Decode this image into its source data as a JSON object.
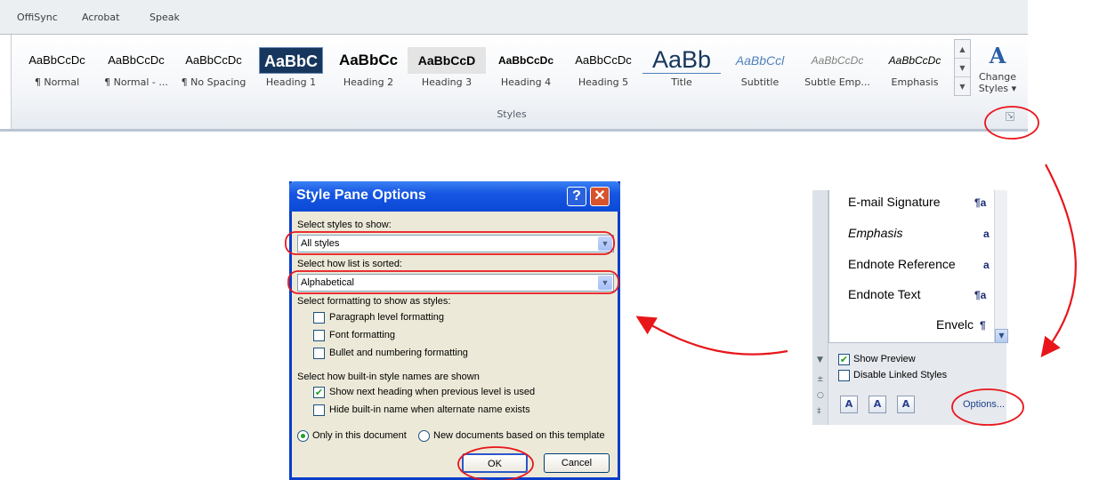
{
  "ribbon": {
    "tabs": [
      {
        "label": "OffiSync"
      },
      {
        "label": "Acrobat"
      },
      {
        "label": "Speak"
      }
    ],
    "gallery": [
      {
        "preview": "AaBbCcDc",
        "name": "¶ Normal"
      },
      {
        "preview": "AaBbCcDc",
        "name": "¶ Normal - ..."
      },
      {
        "preview": "AaBbCcDc",
        "name": "¶ No Spacing"
      },
      {
        "preview": "AaBbC",
        "name": "Heading 1"
      },
      {
        "preview": "AaBbCc",
        "name": "Heading 2"
      },
      {
        "preview": "AaBbCcD",
        "name": "Heading 3"
      },
      {
        "preview": "AaBbCcDc",
        "name": "Heading 4"
      },
      {
        "preview": "AaBbCcDc",
        "name": "Heading 5"
      },
      {
        "preview": "AaBb",
        "name": "Title"
      },
      {
        "preview": "AaBbCcl",
        "name": "Subtitle"
      },
      {
        "preview": "AaBbCcDc",
        "name": "Subtle Emp..."
      },
      {
        "preview": "AaBbCcDc",
        "name": "Emphasis"
      }
    ],
    "change_styles_label": "Change Styles ▾",
    "group_label": "Styles"
  },
  "dialog": {
    "title": "Style Pane Options",
    "help_glyph": "?",
    "close_glyph": "✕",
    "select_styles_label": "Select styles to show:",
    "select_styles_value": "All styles",
    "sort_label": "Select how list is sorted:",
    "sort_value": "Alphabetical",
    "formatting_label": "Select formatting to show as styles:",
    "formatting_options": [
      {
        "label": "Paragraph level formatting",
        "checked": false
      },
      {
        "label": "Font formatting",
        "checked": false
      },
      {
        "label": "Bullet and numbering formatting",
        "checked": false
      }
    ],
    "builtin_label": "Select how built-in style names are shown",
    "builtin_options": [
      {
        "label": "Show next heading when previous level is used",
        "checked": true
      },
      {
        "label": "Hide built-in name when alternate name exists",
        "checked": false
      }
    ],
    "scope_options": [
      {
        "label": "Only in this document",
        "selected": true
      },
      {
        "label": "New documents based on this template",
        "selected": false
      }
    ],
    "ok_label": "OK",
    "cancel_label": "Cancel"
  },
  "styles_pane": {
    "items": [
      {
        "name": "E-mail Signature",
        "mark": "¶a"
      },
      {
        "name": "Emphasis",
        "mark": "a"
      },
      {
        "name": "Endnote Reference",
        "mark": "a"
      },
      {
        "name": "Endnote Text",
        "mark": "¶a"
      },
      {
        "name": "Envelc",
        "mark": "¶"
      }
    ],
    "show_preview_label": "Show Preview",
    "show_preview_checked": true,
    "disable_linked_label": "Disable Linked Styles",
    "disable_linked_checked": false,
    "options_label": "Options..."
  },
  "colors": {
    "annotation_red": "#e8161b",
    "titlebar_blue": "#0a49d6",
    "checkmark_green": "#21a121"
  }
}
